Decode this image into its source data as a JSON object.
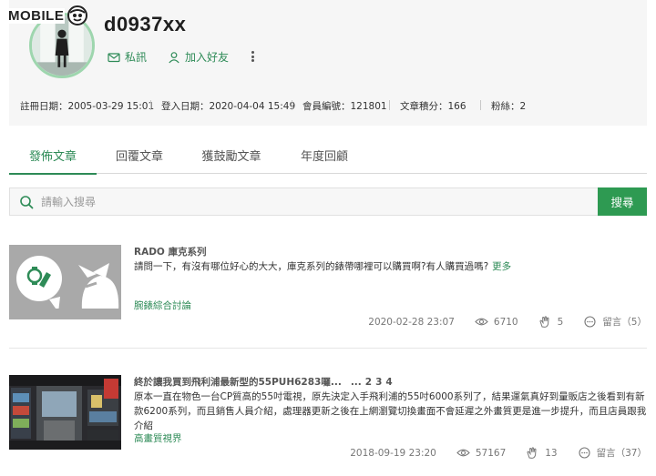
{
  "site": {
    "logo_text": "MOBILE"
  },
  "profile": {
    "username": "d0937xx",
    "actions": {
      "message": "私訊",
      "add_friend": "加入好友"
    },
    "stats": [
      {
        "label": "註冊日期",
        "value": "2005-03-29 15:01"
      },
      {
        "label": "登入日期",
        "value": "2020-04-04 15:49"
      },
      {
        "label": "會員編號",
        "value": "121801"
      },
      {
        "label": "文章積分",
        "value": "166"
      },
      {
        "label": "粉絲",
        "value": "2"
      }
    ]
  },
  "tabs": [
    {
      "label": "發佈文章",
      "active": true
    },
    {
      "label": "回覆文章",
      "active": false
    },
    {
      "label": "獲鼓勵文章",
      "active": false
    },
    {
      "label": "年度回顧",
      "active": false
    }
  ],
  "search": {
    "placeholder": "請輸入搜尋",
    "button_label": "搜尋"
  },
  "posts": [
    {
      "title": "RADO 庫克系列",
      "excerpt": "請問一下，有沒有哪位好心的大大，庫克系列的錶帶哪裡可以購買啊?有人購買過嗎?",
      "more_label": "更多",
      "category": "腕錶綜合討論",
      "date": "2020-02-28 23:07",
      "views": "6710",
      "likes": "5",
      "replies_label": "留言（5）"
    },
    {
      "title": "終於讓我買到飛利浦最新型的55PUH6283囉...",
      "pages": [
        "...",
        "2",
        "3",
        "4"
      ],
      "excerpt": "原本一直在物色一台CP質高的55吋電視，原先決定入手飛利浦的55吋6000系列了，結果運氣真好到量販店之後看到有新款6200系列，而且銷售人員介紹，處理器更新之後在上網瀏覽切換畫面不會延遲之外畫質更是進一步提升，而且店員跟我介紹",
      "category": "高畫質視界",
      "date": "2018-09-19 23:20",
      "views": "57167",
      "likes": "13",
      "replies_label": "留言（37）"
    }
  ],
  "colors": {
    "accent": "#2e8b57",
    "search_button": "#2e9a52",
    "avatar_ring": "#9ed6ae"
  }
}
